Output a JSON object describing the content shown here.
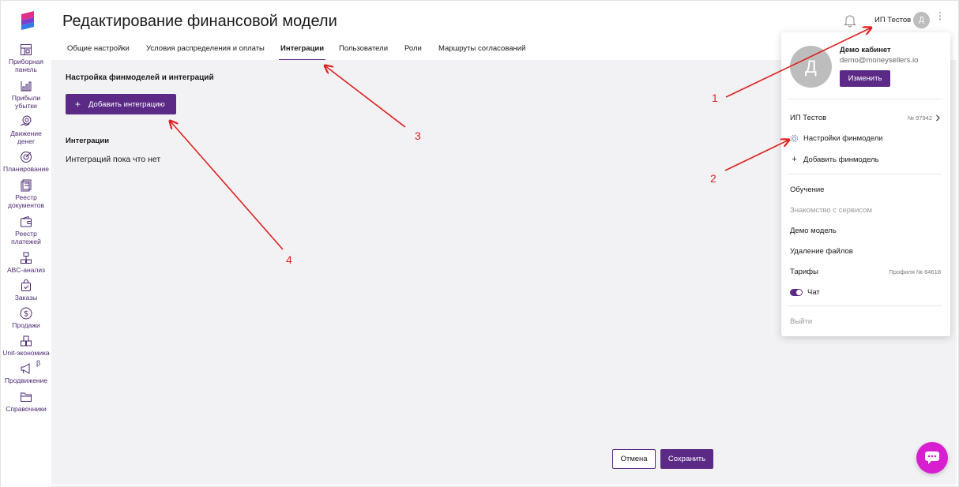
{
  "page": {
    "title": "Редактирование финансовой модели"
  },
  "sidebar": {
    "items": [
      {
        "label": "Приборная\nпанель",
        "icon": "dashboard-icon"
      },
      {
        "label": "Прибыли\nубытки",
        "icon": "chart-icon"
      },
      {
        "label": "Движение\nденег",
        "icon": "money-flow-icon"
      },
      {
        "label": "Планирование",
        "icon": "target-icon"
      },
      {
        "label": "Реестр\nдокументов",
        "icon": "documents-icon"
      },
      {
        "label": "Реестр\nплатежей",
        "icon": "wallet-icon"
      },
      {
        "label": "ABC-анализ",
        "icon": "abc-icon"
      },
      {
        "label": "Заказы",
        "icon": "bag-icon"
      },
      {
        "label": "Продажи",
        "icon": "dollar-icon"
      },
      {
        "label": "Unit-экономика",
        "icon": "boxes-icon"
      },
      {
        "label": "Продвижение",
        "icon": "megaphone-icon",
        "badge": "β"
      },
      {
        "label": "Справочники",
        "icon": "folder-icon"
      }
    ]
  },
  "tabs": [
    {
      "label": "Общие настройки"
    },
    {
      "label": "Условия распределения и оплаты"
    },
    {
      "label": "Интеграции"
    },
    {
      "label": "Пользователи"
    },
    {
      "label": "Роли"
    },
    {
      "label": "Маршруты согласований"
    }
  ],
  "header": {
    "user_name": "ИП Тестов",
    "avatar_letter": "Д"
  },
  "content": {
    "section_title": "Настройка финмоделей и интеграций",
    "add_button": "Добавить интеграцию",
    "integrations_label": "Интеграции",
    "empty_text": "Интеграций пока что нет",
    "cancel": "Отмена",
    "save": "Сохранить"
  },
  "dropdown": {
    "avatar_letter": "Д",
    "company": "Демо кабинет",
    "email": "demo@moneysellers.io",
    "change": "Изменить",
    "org_name": "ИП Тестов",
    "org_number": "№ 97942",
    "settings": "Настройки финмодели",
    "add_model": "Добавить финмодель",
    "training": "Обучение",
    "intro": "Знакомство с сервисом",
    "demo_model": "Демо модель",
    "delete_files": "Удаление файлов",
    "tariffs": "Тарифы",
    "profile_number": "Профиля № 64618",
    "chat": "Чат",
    "logout": "Выйти"
  },
  "annotations": [
    "1",
    "2",
    "3",
    "4"
  ],
  "colors": {
    "accent": "#5b2a86",
    "chat_fab": "#d81fd0",
    "annotation": "#e02020"
  }
}
